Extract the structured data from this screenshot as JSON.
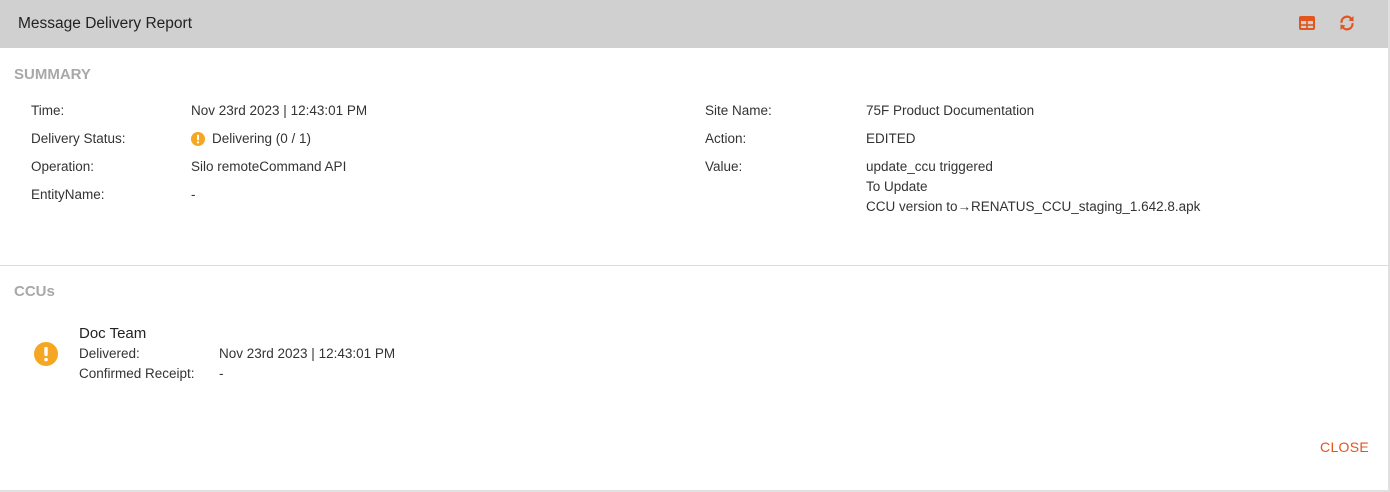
{
  "dialog": {
    "title": "Message Delivery Report",
    "header_icons": [
      "table-grid-icon",
      "refresh-icon"
    ],
    "accent_color": "#e2551f"
  },
  "summary": {
    "section_title": "SUMMARY",
    "time_label": "Time:",
    "time_value": "Nov 23rd 2023 | 12:43:01 PM",
    "delivery_status_label": "Delivery Status:",
    "delivery_status_value": "Delivering (0 / 1)",
    "operation_label": "Operation:",
    "operation_value": "Silo remoteCommand API",
    "entity_name_label": "EntityName:",
    "entity_name_value": "-",
    "site_name_label": "Site Name:",
    "site_name_value": "75F Product Documentation",
    "action_label": "Action:",
    "action_value": "EDITED",
    "value_label": "Value:",
    "value_lines": [
      "update_ccu triggered",
      "To Update",
      "CCU version to→RENATUS_CCU_staging_1.642.8.apk"
    ]
  },
  "ccus": {
    "section_title": "CCUs",
    "items": [
      {
        "name": "Doc Team",
        "status_icon": "warning-icon",
        "delivered_label": "Delivered:",
        "delivered_value": "Nov 23rd 2023 | 12:43:01 PM",
        "confirmed_label": "Confirmed Receipt:",
        "confirmed_value": "-"
      }
    ]
  },
  "footer": {
    "close_label": "CLOSE"
  },
  "colors": {
    "header_bg": "#d0d0d0",
    "warning": "#f5a623",
    "section_title": "#a8a8a8"
  }
}
